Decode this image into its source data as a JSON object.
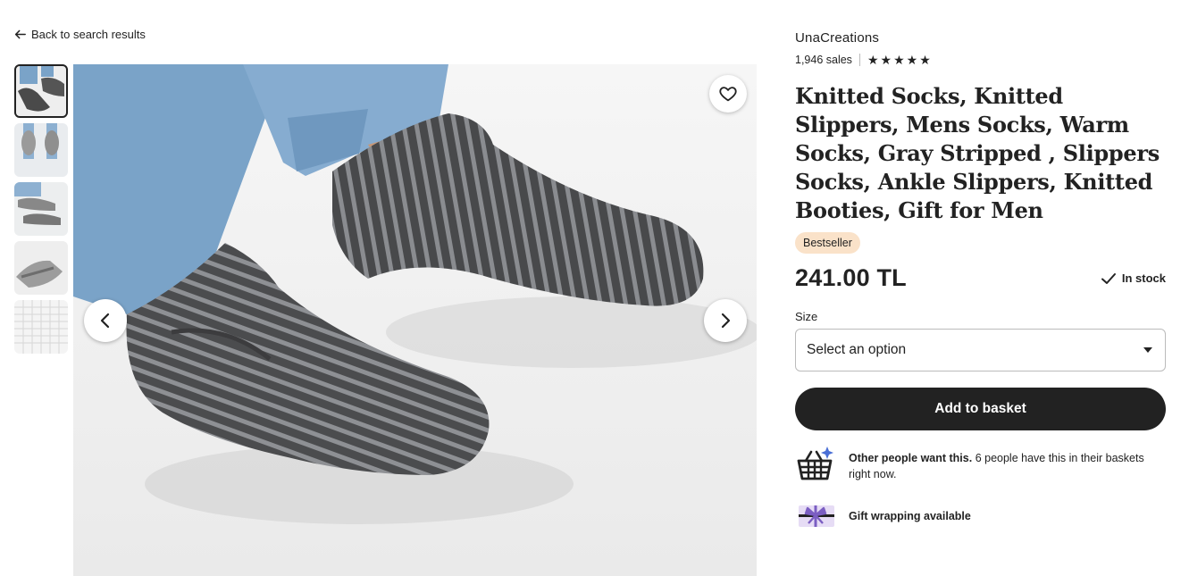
{
  "nav": {
    "back_label": "Back to search results"
  },
  "shop": {
    "name": "UnaCreations",
    "sales": "1,946 sales",
    "rating_stars": 5
  },
  "product": {
    "title": "Knitted Socks, Knitted Slippers, Mens Socks, Warm Socks, Gray Stripped , Slippers Socks, Ankle Slippers, Knitted Booties, Gift for Men",
    "badge": "Bestseller",
    "price": "241.00 TL",
    "stock": "In stock"
  },
  "options": {
    "size_label": "Size",
    "size_value": "Select an option"
  },
  "actions": {
    "add_to_basket": "Add to basket"
  },
  "info": {
    "demand_bold": "Other people want this.",
    "demand_text": " 6 people have this in their baskets right now.",
    "gift": "Gift wrapping available"
  },
  "gallery": {
    "thumbnail_count": 5,
    "active_index": 0
  },
  "colors": {
    "accent": "#222222",
    "badge_bg": "#fae2c9",
    "gift_icon": "#7b5ec2",
    "basket_sparkle": "#4a6fd6"
  },
  "icons": [
    "arrow-left-icon",
    "heart-icon",
    "chevron-left-icon",
    "chevron-right-icon",
    "star-icon",
    "check-icon",
    "caret-down-icon",
    "basket-icon",
    "gift-icon"
  ]
}
